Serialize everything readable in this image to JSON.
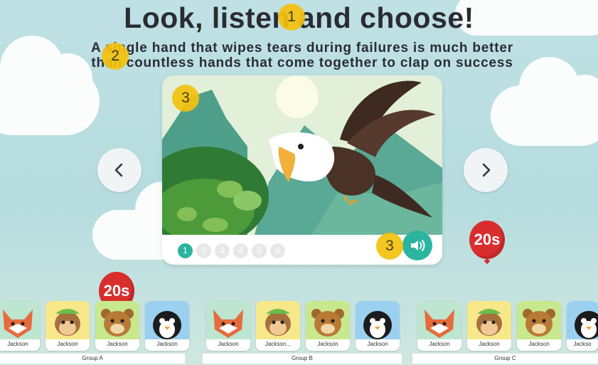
{
  "header": {
    "title": "Look, listen and choose!",
    "subtitle_line1": "A single hand that wipes tears during failures is much better",
    "subtitle_line2": "than countless hands that come together to clap on success"
  },
  "badges": {
    "b1": "1",
    "b2": "2",
    "b3": "3",
    "b4": "3"
  },
  "icons": {
    "prev": "chevron-left-icon",
    "next": "chevron-right-icon",
    "sound": "speaker-icon",
    "illustration": "eagle-illustration"
  },
  "pagination": {
    "pages": [
      "1",
      "2",
      "3",
      "4",
      "5",
      "6"
    ],
    "current": 1
  },
  "timers": {
    "right": "20s",
    "left": "20s"
  },
  "groups": [
    {
      "label": "Group A",
      "players": [
        {
          "name": "Jackson",
          "avatar": "fox"
        },
        {
          "name": "Jackson",
          "avatar": "monkey"
        },
        {
          "name": "Jackson",
          "avatar": "bear"
        },
        {
          "name": "Jackson",
          "avatar": "penguin"
        }
      ]
    },
    {
      "label": "Group B",
      "players": [
        {
          "name": "Jackson",
          "avatar": "fox"
        },
        {
          "name": "Jackson...",
          "avatar": "monkey"
        },
        {
          "name": "Jackson",
          "avatar": "bear"
        },
        {
          "name": "Jackson",
          "avatar": "penguin"
        }
      ]
    },
    {
      "label": "Group C",
      "players": [
        {
          "name": "Jackson",
          "avatar": "fox"
        },
        {
          "name": "Jackson",
          "avatar": "monkey"
        },
        {
          "name": "Jackson",
          "avatar": "bear"
        },
        {
          "name": "Jackso",
          "avatar": "penguin"
        }
      ]
    }
  ],
  "colors": {
    "accent": "#2bb5a0",
    "badge": "#f4c20f",
    "timer": "#d92e2e",
    "sky": "#bfe1e4"
  }
}
